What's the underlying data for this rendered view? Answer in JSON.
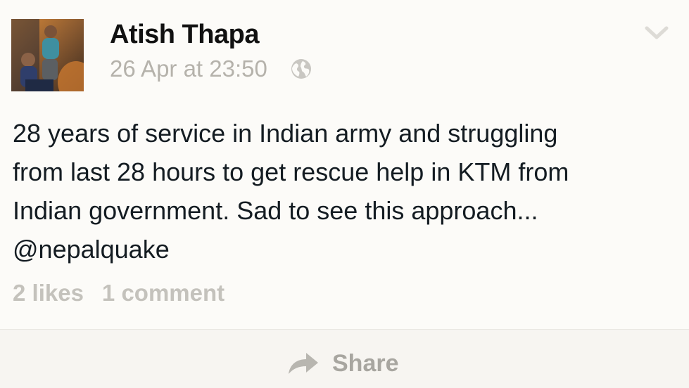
{
  "post": {
    "author": "Atish Thapa",
    "timestamp": "26 Apr at 23:50",
    "privacy_icon": "globe-icon",
    "menu_icon": "chevron-down-icon",
    "text_lines": [
      "28 years of service in Indian army and struggling",
      "from last 28 hours to get rescue help in KTM from",
      "Indian government. Sad to see this approach...",
      "@nepalquake"
    ],
    "likes": "2 likes",
    "comments": "1 comment"
  },
  "actions": {
    "share_label": "Share",
    "share_icon": "share-arrow-icon"
  },
  "colors": {
    "background": "#fcfbf8",
    "author": "#111111",
    "muted": "#b5b2ab",
    "body_text": "#141c22"
  }
}
